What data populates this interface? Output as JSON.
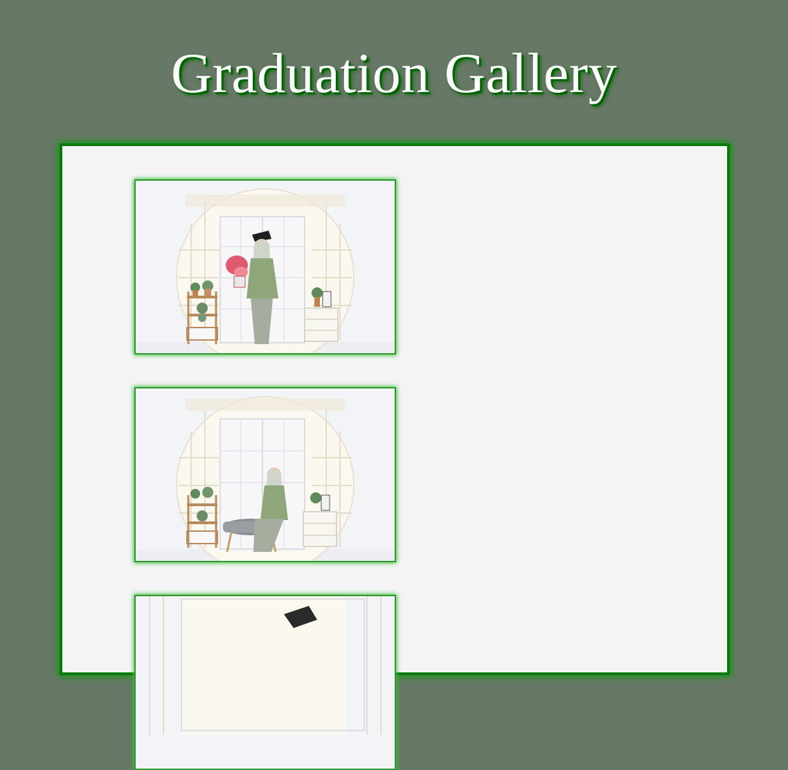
{
  "page": {
    "title": "Graduation Gallery"
  },
  "colors": {
    "background": "#677866",
    "panel": "#f4f4f4",
    "panel_border": "#0a7a0a",
    "title_text": "#ffffff",
    "title_shadow": "#006400"
  },
  "gallery": {
    "photos": [
      {
        "name": "graduation-photo-standing"
      },
      {
        "name": "graduation-photo-seated"
      },
      {
        "name": "graduation-photo-third"
      }
    ]
  }
}
